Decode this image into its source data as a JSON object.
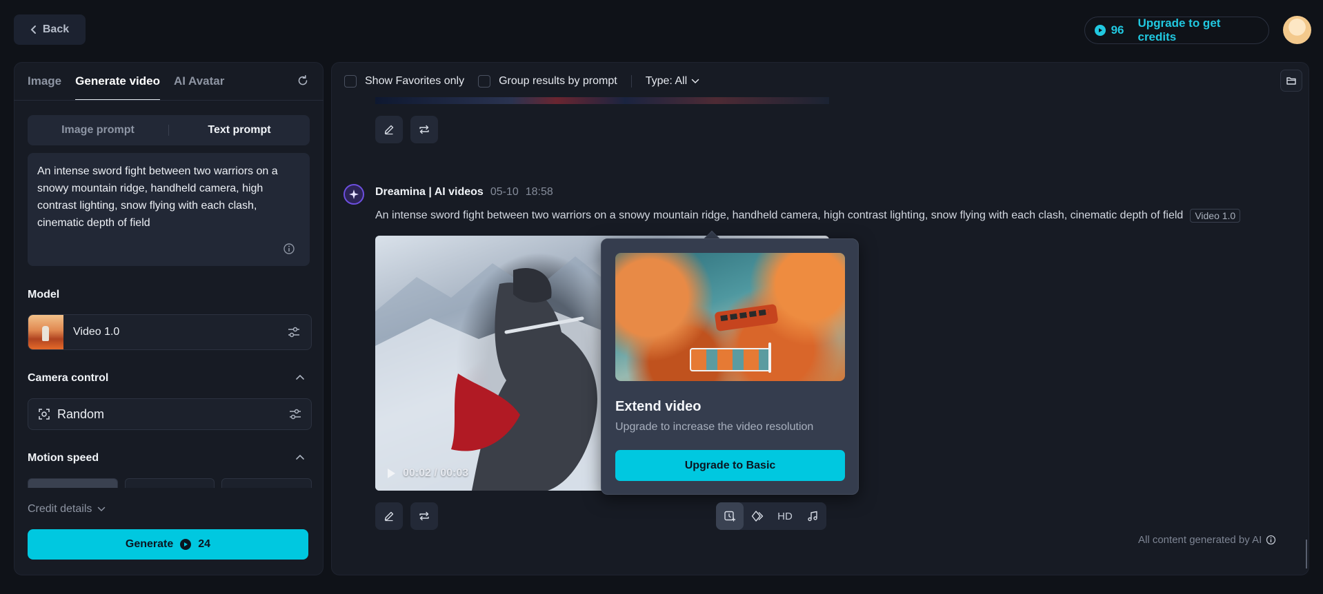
{
  "topbar": {
    "back_label": "Back",
    "credits_count": "96",
    "upgrade_label": "Upgrade to get credits"
  },
  "left": {
    "tabs": [
      {
        "label": "Image"
      },
      {
        "label": "Generate video"
      },
      {
        "label": "AI Avatar"
      }
    ],
    "prompt_modes": {
      "image": "Image prompt",
      "text": "Text prompt"
    },
    "prompt_text": "An intense sword fight between two warriors on a snowy mountain ridge, handheld camera, high contrast lighting, snow flying with each clash, cinematic depth of field",
    "model_label": "Model",
    "model_name": "Video 1.0",
    "camera_label": "Camera control",
    "camera_value": "Random",
    "motion_label": "Motion speed",
    "credit_details_label": "Credit details",
    "generate_label": "Generate",
    "generate_cost": "24"
  },
  "right": {
    "filters": {
      "favorites": "Show Favorites only",
      "group": "Group results by prompt",
      "type": "Type: All"
    },
    "entry": {
      "author": "Dreamina | AI videos",
      "date": "05-10",
      "time": "18:58",
      "prompt": "An intense sword fight between two warriors on a snowy mountain ridge, handheld camera, high contrast lighting, snow flying with each clash, cinematic depth of field",
      "model_tag": "Video 1.0",
      "video_time": "00:02 / 00:03",
      "hd_label": "HD"
    },
    "popup": {
      "title": "Extend video",
      "subtitle": "Upgrade to increase the video resolution",
      "button": "Upgrade to Basic"
    },
    "footer_note": "All content generated by AI"
  },
  "colors": {
    "accent": "#00c8e0",
    "background": "#0f1218",
    "panel": "#171b24"
  }
}
